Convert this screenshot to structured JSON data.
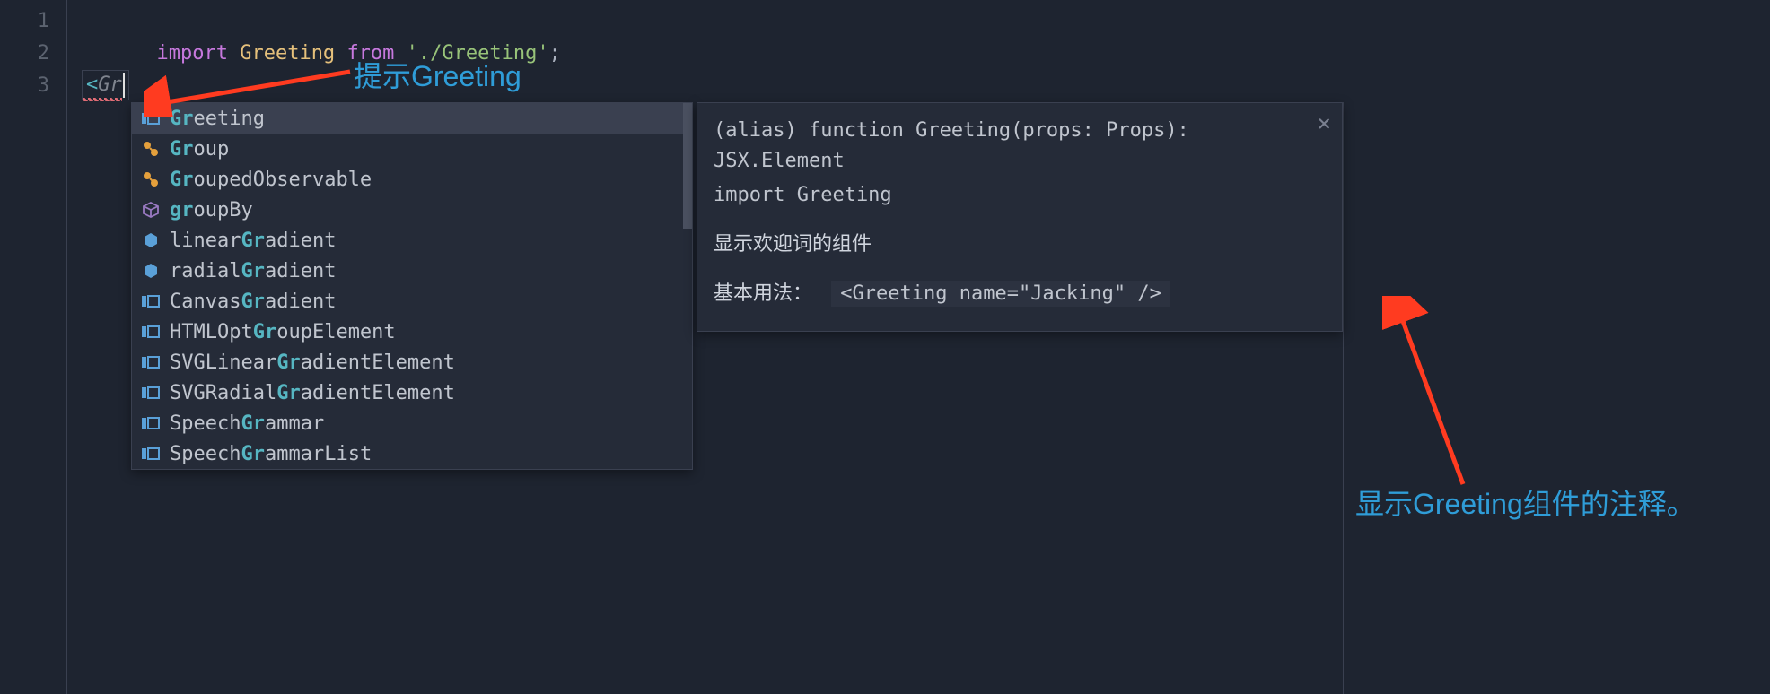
{
  "gutter": {
    "lines": [
      "1",
      "2",
      "3"
    ]
  },
  "code": {
    "line1": {
      "import": "import",
      "ident": "Greeting",
      "from": "from",
      "string": "'./Greeting'",
      "semi": ";"
    },
    "line3": {
      "open": "<",
      "partial": "Gr"
    }
  },
  "annot": {
    "a1": "提示Greeting",
    "a2": "显示Greeting组件的注释。"
  },
  "autocomplete": {
    "items": [
      {
        "icon": "block",
        "pre": "",
        "match": "Gr",
        "post": "eeting",
        "selected": true
      },
      {
        "icon": "class",
        "pre": "",
        "match": "Gr",
        "post": "oup",
        "selected": false
      },
      {
        "icon": "class",
        "pre": "",
        "match": "Gr",
        "post": "oupedObservable",
        "selected": false
      },
      {
        "icon": "cube",
        "pre": "",
        "match": "gr",
        "post": "oupBy",
        "selected": false
      },
      {
        "icon": "hex",
        "pre": "linear",
        "match": "Gr",
        "post": "adient",
        "selected": false
      },
      {
        "icon": "hex",
        "pre": "radial",
        "match": "Gr",
        "post": "adient",
        "selected": false
      },
      {
        "icon": "block",
        "pre": "Canvas",
        "match": "Gr",
        "post": "adient",
        "selected": false
      },
      {
        "icon": "block",
        "pre": "HTMLOpt",
        "match": "Gr",
        "post": "oupElement",
        "selected": false
      },
      {
        "icon": "block",
        "pre": "SVGLinear",
        "match": "Gr",
        "post": "adientElement",
        "selected": false
      },
      {
        "icon": "block",
        "pre": "SVGRadial",
        "match": "Gr",
        "post": "adientElement",
        "selected": false
      },
      {
        "icon": "block",
        "pre": "Speech",
        "match": "Gr",
        "post": "ammar",
        "selected": false
      },
      {
        "icon": "block",
        "pre": "Speech",
        "match": "Gr",
        "post": "ammarList",
        "selected": false
      }
    ]
  },
  "doc": {
    "sig": "(alias) function Greeting(props: Props): JSX.Element",
    "importLine": "import Greeting",
    "desc": "显示欢迎词的组件",
    "usageLabel": "基本用法：",
    "usageCode": "<Greeting name=\"Jacking\" />",
    "close": "×"
  }
}
